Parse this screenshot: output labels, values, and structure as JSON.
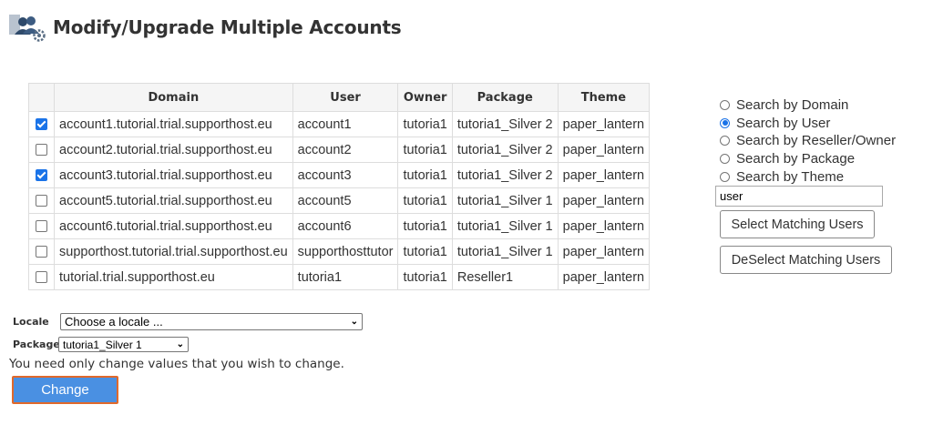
{
  "page": {
    "title": "Modify/Upgrade Multiple Accounts",
    "icon": "users-gear-icon"
  },
  "table": {
    "headers": [
      "Domain",
      "User",
      "Owner",
      "Package",
      "Theme"
    ],
    "rows": [
      {
        "checked": true,
        "domain": "account1.tutorial.trial.supporthost.eu",
        "user": "account1",
        "owner": "tutoria1",
        "package": "tutoria1_Silver 2",
        "theme": "paper_lantern"
      },
      {
        "checked": false,
        "domain": "account2.tutorial.trial.supporthost.eu",
        "user": "account2",
        "owner": "tutoria1",
        "package": "tutoria1_Silver 2",
        "theme": "paper_lantern"
      },
      {
        "checked": true,
        "domain": "account3.tutorial.trial.supporthost.eu",
        "user": "account3",
        "owner": "tutoria1",
        "package": "tutoria1_Silver 2",
        "theme": "paper_lantern"
      },
      {
        "checked": false,
        "domain": "account5.tutorial.trial.supporthost.eu",
        "user": "account5",
        "owner": "tutoria1",
        "package": "tutoria1_Silver 1",
        "theme": "paper_lantern"
      },
      {
        "checked": false,
        "domain": "account6.tutorial.trial.supporthost.eu",
        "user": "account6",
        "owner": "tutoria1",
        "package": "tutoria1_Silver 1",
        "theme": "paper_lantern"
      },
      {
        "checked": false,
        "domain": "supporthost.tutorial.trial.supporthost.eu",
        "user": "supporthosttutor",
        "owner": "tutoria1",
        "package": "tutoria1_Silver 1",
        "theme": "paper_lantern"
      },
      {
        "checked": false,
        "domain": "tutorial.trial.supporthost.eu",
        "user": "tutoria1",
        "owner": "tutoria1",
        "package": "Reseller1",
        "theme": "paper_lantern"
      }
    ]
  },
  "search": {
    "options": [
      {
        "label": "Search by Domain",
        "selected": false
      },
      {
        "label": "Search by User",
        "selected": true
      },
      {
        "label": "Search by Reseller/Owner",
        "selected": false
      },
      {
        "label": "Search by Package",
        "selected": false
      },
      {
        "label": "Search by Theme",
        "selected": false
      }
    ],
    "query": "user",
    "select_button": "Select Matching Users",
    "deselect_button": "DeSelect Matching Users"
  },
  "form": {
    "locale_label": "Locale",
    "locale_value": "Choose a locale ...",
    "package_label": "Package",
    "package_value": "tutoria1_Silver 1",
    "note": "You need only change values that you wish to change.",
    "change_button": "Change"
  },
  "colors": {
    "accent": "#1a73e8",
    "button_bg": "#4a90e2",
    "button_border": "#e0692b"
  }
}
